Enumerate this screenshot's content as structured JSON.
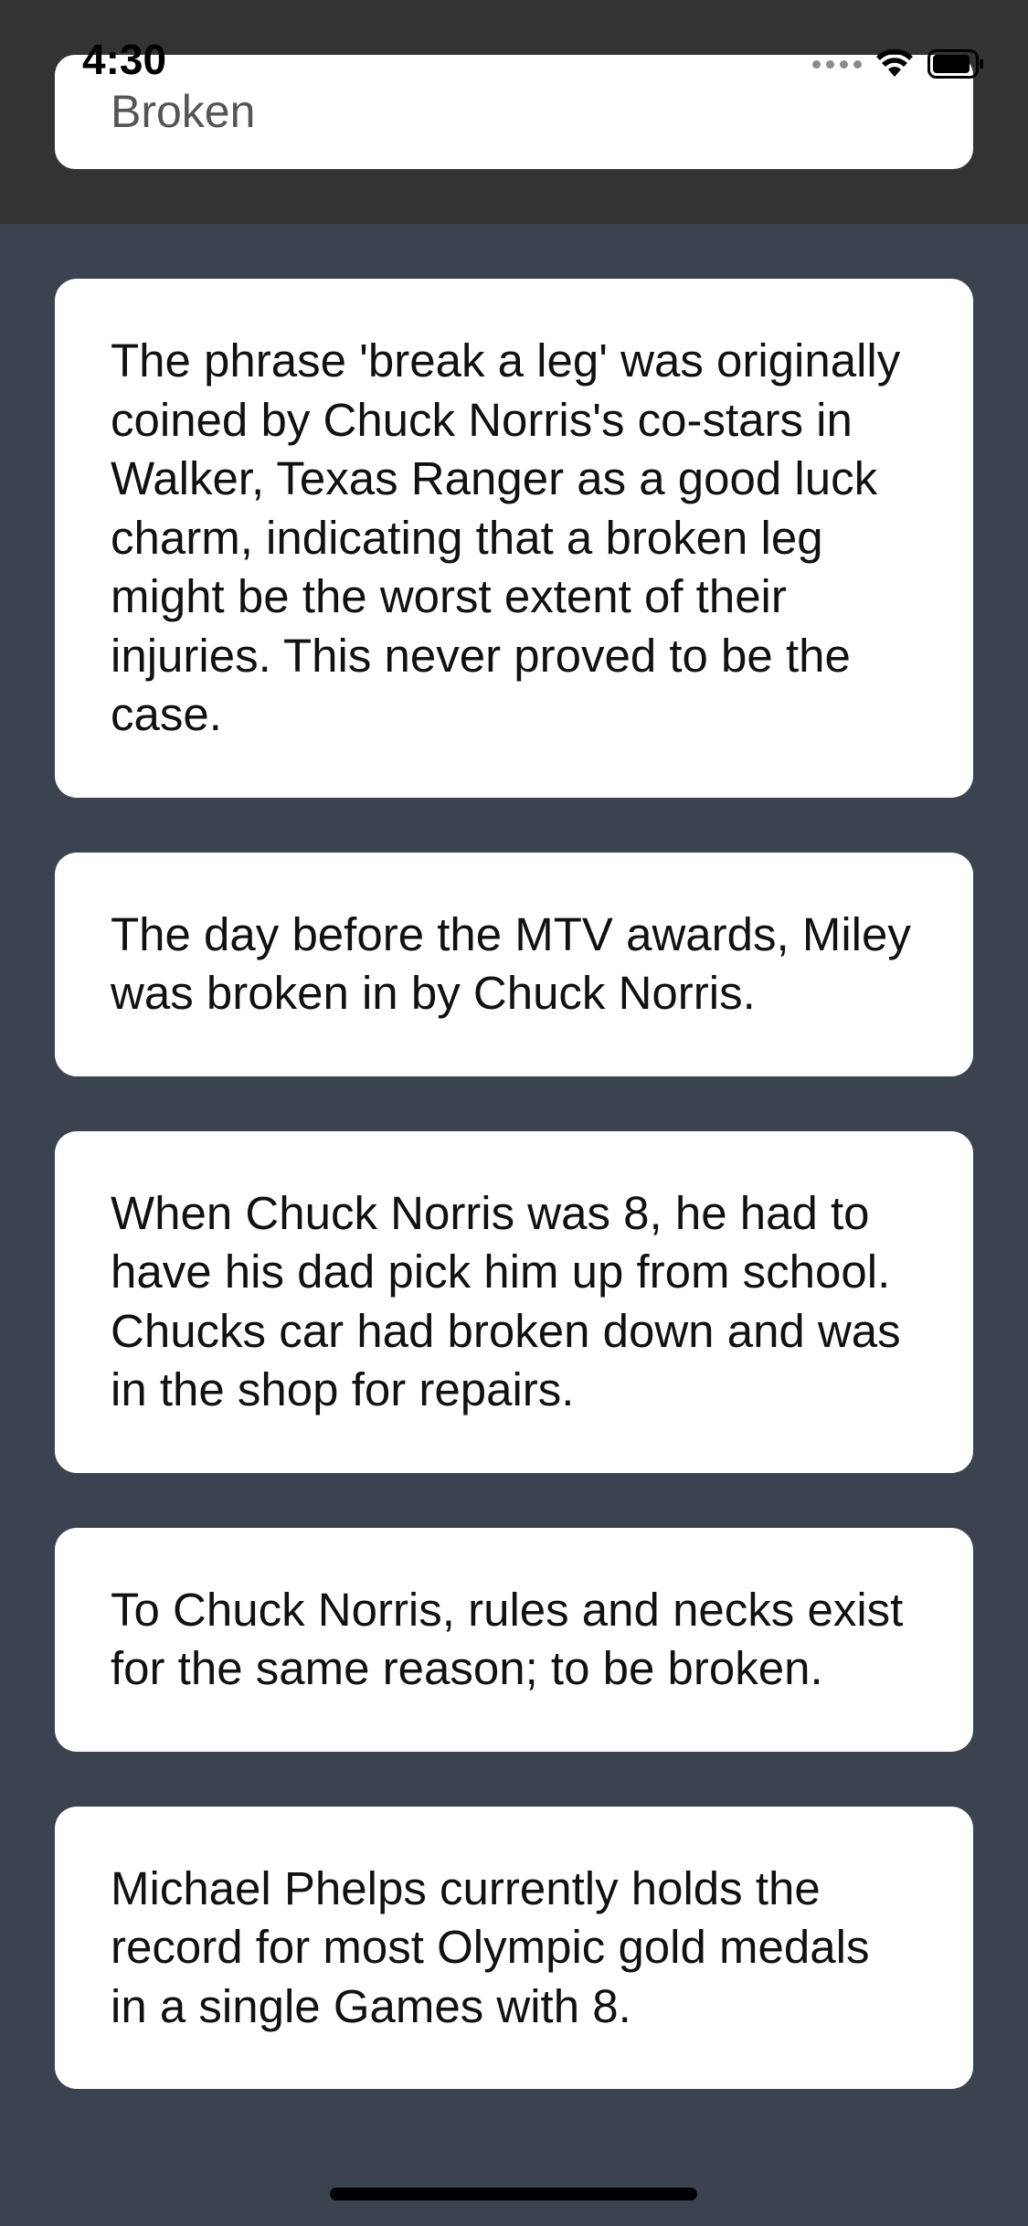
{
  "status_bar": {
    "time": "4:30",
    "wifi_icon": "wifi-icon",
    "battery_icon": "battery-icon"
  },
  "search": {
    "value": "Broken"
  },
  "jokes": [
    {
      "text": "The phrase 'break a leg' was originally coined by Chuck Norris's co-stars in Walker, Texas Ranger as a good luck charm, indicating that a broken leg might be the worst extent of their injuries. This never proved to be the case."
    },
    {
      "text": "The day before the MTV awards, Miley was broken in by Chuck Norris."
    },
    {
      "text": "When Chuck Norris was 8, he had to have his dad pick him up from school. Chucks car had broken down and was in the shop for repairs."
    },
    {
      "text": "To Chuck Norris, rules and necks exist for the same reason; to be broken."
    },
    {
      "text": "Michael Phelps currently holds the record for most Olympic gold medals in a single Games with 8."
    }
  ],
  "colors": {
    "header_bg": "#333333",
    "content_bg": "#3b4250",
    "card_bg": "#ffffff"
  }
}
